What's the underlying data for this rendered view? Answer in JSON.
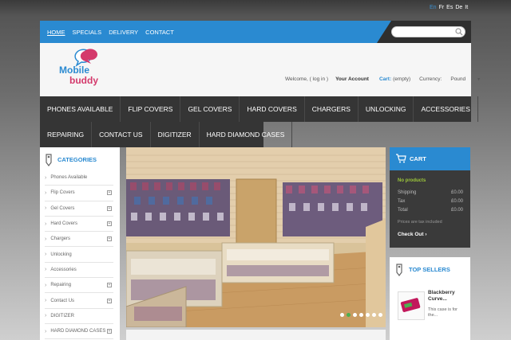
{
  "languages": [
    "En",
    "Fr",
    "Es",
    "De",
    "It"
  ],
  "top_nav": [
    "HOME",
    "SPECIALS",
    "DELIVERY",
    "CONTACT"
  ],
  "search": {
    "placeholder": ""
  },
  "logo": {
    "line1": "Mobile",
    "line2": "buddy"
  },
  "userbar": {
    "welcome": "Welcome, ( log in )",
    "account": "Your Account",
    "cart_label": "Cart:",
    "cart_value": "(empty)",
    "currency_label": "Currency:",
    "currency_value": "Pound"
  },
  "main_nav_row1": [
    "PHONES AVAILABLE",
    "FLIP COVERS",
    "GEL COVERS",
    "HARD COVERS",
    "CHARGERS",
    "UNLOCKING",
    "ACCESSORIES"
  ],
  "main_nav_row2": [
    "REPAIRING",
    "CONTACT US",
    "DIGITIZER",
    "HARD DIAMOND CASES"
  ],
  "categories": {
    "title": "CATEGORIES",
    "items": [
      {
        "label": "Phones Available",
        "expand": false
      },
      {
        "label": "Flip Covers",
        "expand": true
      },
      {
        "label": "Gel Covers",
        "expand": true
      },
      {
        "label": "Hard Covers",
        "expand": true
      },
      {
        "label": "Chargers",
        "expand": true
      },
      {
        "label": "Unlocking",
        "expand": false
      },
      {
        "label": "Accessories",
        "expand": false
      },
      {
        "label": "Repairing",
        "expand": true
      },
      {
        "label": "Contact Us",
        "expand": true
      },
      {
        "label": "DIGITIZER",
        "expand": false
      },
      {
        "label": "HARD DIAMOND CASES",
        "expand": true
      }
    ]
  },
  "slider": {
    "dot_count": 7,
    "active_dot": 1
  },
  "cart_block": {
    "title": "CART",
    "no_products": "No products",
    "lines": [
      {
        "label": "Shipping",
        "value": "£0.00"
      },
      {
        "label": "Tax",
        "value": "£0.00"
      },
      {
        "label": "Total",
        "value": "£0.00"
      }
    ],
    "tax_note": "Prices are tax included",
    "checkout": "Check Out"
  },
  "top_sellers": {
    "title": "TOP SELLERS",
    "product_name": "Blackberry Curve...",
    "product_desc": "This case is for the..."
  },
  "colors": {
    "accent_blue": "#2a8ad1",
    "brand_pink": "#d43a6c",
    "nav_dark": "#353535",
    "highlight_green": "#9cc63a"
  }
}
